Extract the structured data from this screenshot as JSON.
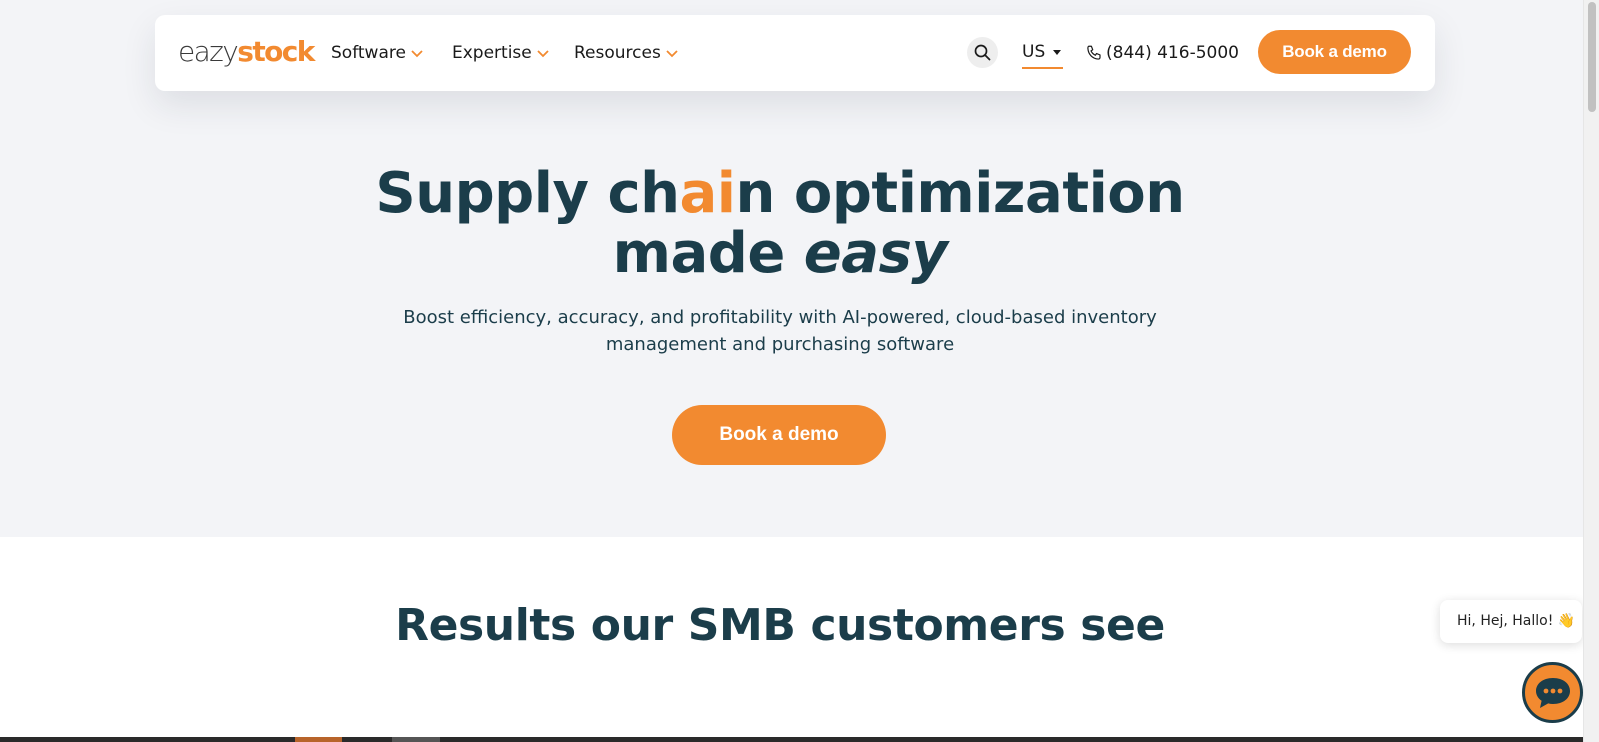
{
  "brand": {
    "logo_light": "eazy",
    "logo_bold": "stock",
    "accent_color": "#f28a30",
    "text_color": "#1b3d4a"
  },
  "nav": {
    "items": [
      {
        "label": "Software"
      },
      {
        "label": "Expertise"
      },
      {
        "label": "Resources"
      }
    ],
    "region": "US",
    "phone": "(844) 416-5000",
    "cta_label": "Book a demo"
  },
  "hero": {
    "title_part1": "Supply ch",
    "title_accent": "ai",
    "title_part2": "n optimization",
    "title_line2_plain": "made ",
    "title_line2_italic": "easy",
    "subtitle": "Boost efficiency, accuracy, and profitability with AI-powered, cloud-based inventory management and purchasing software",
    "cta_label": "Book a demo"
  },
  "results": {
    "title": "Results our SMB customers see"
  },
  "chat": {
    "greeting": "Hi, Hej, Hallo! 👋"
  },
  "icons": {
    "search": "search-icon",
    "phone": "phone-icon",
    "chevron": "chevron-down-icon",
    "chat": "chat-icon",
    "wave": "waving-hand-icon"
  }
}
